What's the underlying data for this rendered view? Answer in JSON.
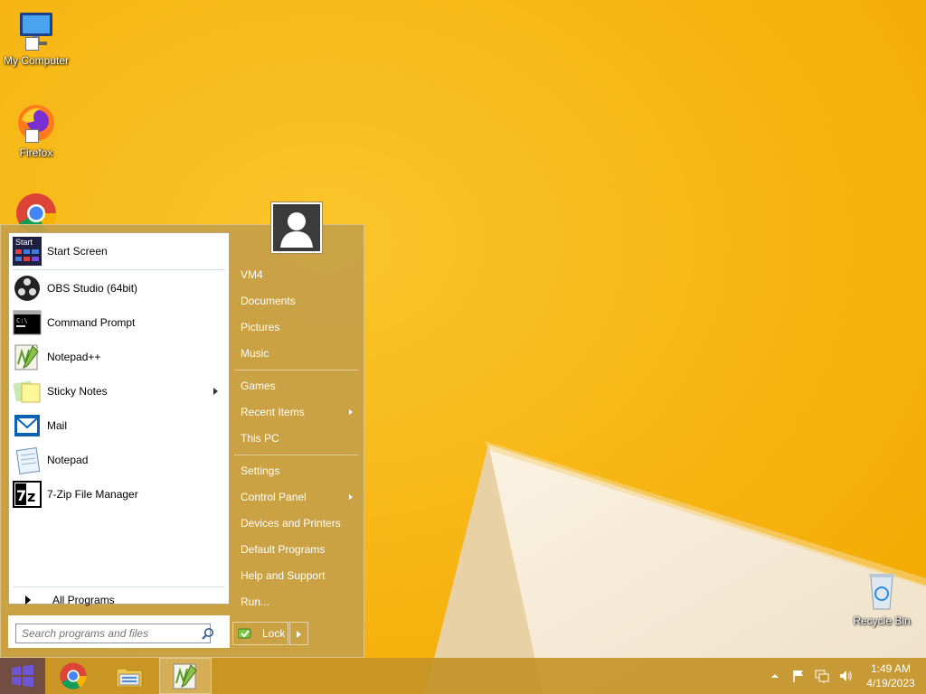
{
  "desktop": {
    "icons": [
      {
        "label": "My Computer",
        "icon": "computer-icon"
      },
      {
        "label": "Firefox",
        "icon": "firefox-icon"
      },
      {
        "label": "Chrome",
        "icon": "chrome-icon"
      },
      {
        "label": "Recycle Bin",
        "icon": "recycle-bin-icon"
      }
    ]
  },
  "start_menu": {
    "pinned": [
      {
        "label": "Start Screen",
        "icon": "start-screen-icon",
        "submenu": false
      }
    ],
    "recent": [
      {
        "label": "OBS Studio (64bit)",
        "icon": "obs-icon",
        "submenu": false
      },
      {
        "label": "Command Prompt",
        "icon": "cmd-icon",
        "submenu": false
      },
      {
        "label": "Notepad++",
        "icon": "notepadpp-icon",
        "submenu": false
      },
      {
        "label": "Sticky Notes",
        "icon": "sticky-notes-icon",
        "submenu": true
      },
      {
        "label": "Mail",
        "icon": "mail-icon",
        "submenu": false
      },
      {
        "label": "Notepad",
        "icon": "notepad-icon",
        "submenu": false
      },
      {
        "label": "7-Zip File Manager",
        "icon": "seven-zip-icon",
        "submenu": false
      }
    ],
    "start_tile_text": "Start",
    "all_programs": "All Programs",
    "search_placeholder": "Search programs and files",
    "right_groups": [
      [
        "VM4",
        "Documents",
        "Pictures",
        "Music"
      ],
      [
        "Games",
        "Recent Items",
        "This PC"
      ],
      [
        "Settings",
        "Control Panel",
        "Devices and Printers",
        "Default Programs",
        "Help and Support",
        "Run..."
      ]
    ],
    "right_submenus": [
      "Recent Items",
      "Control Panel"
    ],
    "lock_label": "Lock"
  },
  "taskbar": {
    "apps": [
      "start-button",
      "chrome-icon",
      "file-explorer-icon",
      "notepadpp-icon"
    ],
    "active": "notepadpp-icon",
    "clock_time": "1:49 AM",
    "clock_date": "4/19/2023"
  },
  "colors": {
    "wallpaper": "#f6b10a",
    "menu": "#c6a048",
    "windows_logo": "#5a3fbf"
  }
}
